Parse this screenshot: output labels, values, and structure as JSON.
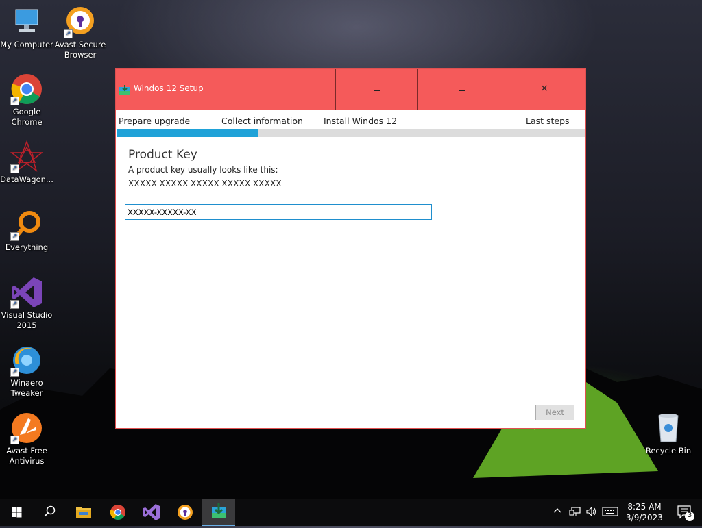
{
  "desktop": {
    "icons": [
      {
        "label": "My Computer",
        "icon": "computer-icon"
      },
      {
        "label": "Avast Secure Browser",
        "icon": "avast-secure-browser-icon"
      },
      {
        "label": "Google Chrome",
        "icon": "chrome-icon"
      },
      {
        "label": "DataWagon...",
        "icon": "datawagon-icon"
      },
      {
        "label": "Everything",
        "icon": "everything-search-icon"
      },
      {
        "label": "Visual Studio 2015",
        "icon": "visual-studio-icon"
      },
      {
        "label": "Winaero Tweaker",
        "icon": "winaero-tweaker-icon"
      },
      {
        "label": "Avast Free Antivirus",
        "icon": "avast-antivirus-icon"
      },
      {
        "label": "Recycle Bin",
        "icon": "recycle-bin-icon"
      }
    ]
  },
  "window": {
    "title": "Windos 12 Setup",
    "close_glyph": "×",
    "steps": [
      "Prepare upgrade",
      "Collect information",
      "Install Windos 12",
      "Last steps"
    ],
    "progress_fraction": 0.3,
    "section_title": "Product Key",
    "description": "A product key usually looks like this:",
    "example_key": "XXXXX-XXXXX-XXXXX-XXXXX-XXXXX",
    "key_input_value": "XXXXX-XXXXX-XX",
    "next_label": "Next",
    "title_color": "#f55a5a",
    "accent_color": "#1fa2d8"
  },
  "taskbar": {
    "apps": [
      "start-icon",
      "search-icon",
      "file-explorer-icon",
      "chrome-icon",
      "visual-studio-icon",
      "avast-secure-browser-icon",
      "setup-icon"
    ],
    "clock_time": "8:25 AM",
    "clock_date": "3/9/2023",
    "notification_count": "3"
  }
}
